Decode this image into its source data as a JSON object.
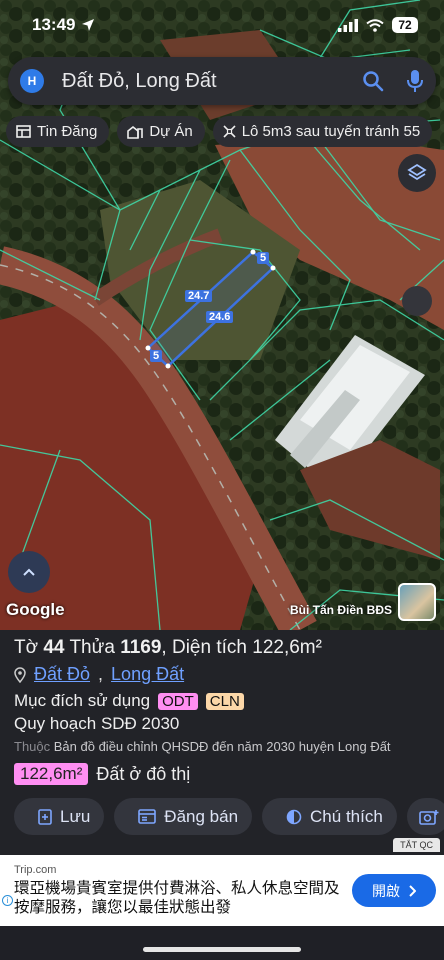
{
  "status": {
    "time": "13:49",
    "battery": "72"
  },
  "search": {
    "avatar_letter": "H",
    "query": "Đất Đỏ, Long Đất"
  },
  "chips": [
    {
      "icon": "table-icon",
      "label": "Tin Đăng"
    },
    {
      "icon": "building-icon",
      "label": "Dự Án"
    },
    {
      "icon": "ruler-icon",
      "label": "Lô 5m3 sau tuyến tránh 55"
    }
  ],
  "map": {
    "dims": {
      "top": "5",
      "left_long": "24.7",
      "right_long": "24.6",
      "bottom": "5"
    },
    "google": "Google",
    "author": "Bùi Tấn Điền BĐS"
  },
  "panel": {
    "title_prefix": "Tờ",
    "sheet_no": "44",
    "parcel_label": "Thửa",
    "parcel_no": "1169",
    "area_label": "Diện tích",
    "area_value": "122,6m²",
    "location": {
      "ward": "Đất Đỏ",
      "district": "Long Đất"
    },
    "purpose_label": "Mục đích sử dụng",
    "purpose_tags": [
      "ODT",
      "CLN"
    ],
    "plan": "Quy hoạch SDĐ 2030",
    "belongs_prefix": "Thuộc",
    "belongs_text": "Bản đồ điều chỉnh QHSDĐ đến năm 2030 huyện Long Đất",
    "area_badge": "122,6m²",
    "area_type": "Đất ở đô thị",
    "actions": [
      "Lưu",
      "Đăng bán",
      "Chú thích"
    ]
  },
  "ad": {
    "label": "TẮT QC",
    "site": "Trip.com",
    "text": "環亞機場貴賓室提供付費淋浴、私人休息空間及按摩服務，讓您以最佳狀態出發",
    "button": "開啟"
  },
  "colors": {
    "accent": "#3d72e0",
    "odt": "#ff8ef2",
    "cln": "#fcd7a8",
    "ad_button": "#1a6ae6"
  }
}
